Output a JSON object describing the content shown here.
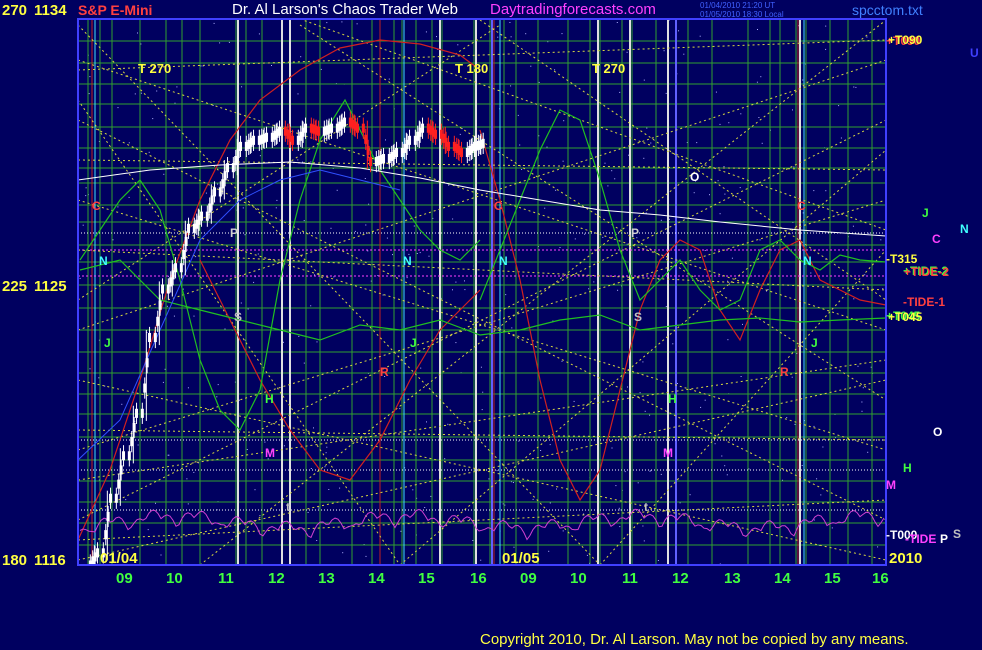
{
  "header": {
    "scale_top": "270",
    "price_top": "1134",
    "symbol": "S&P E-Mini",
    "title": "Dr. Al Larson's Chaos Trader Web",
    "site": "Daytradingforecasts.com",
    "stamp1": "01/04/2010 21:20 UT",
    "stamp2": "01/05/2010 18:30 Local",
    "file": "spcctom.txt"
  },
  "y_axis": {
    "mid_scale": "225",
    "mid_price": "1125",
    "bottom_scale": "180",
    "bottom_price": "1116"
  },
  "x_axis": {
    "dates": [
      "01/04",
      "01/05"
    ],
    "hours_day1": [
      "09",
      "10",
      "11",
      "12",
      "13",
      "14",
      "15",
      "16"
    ],
    "hours_day2": [
      "09",
      "10",
      "11",
      "12",
      "13",
      "14",
      "15",
      "16"
    ],
    "year": "2010"
  },
  "markers": {
    "t270": "T  270",
    "t180": "T  180",
    "t270b": "T  270",
    "planet_c": "C",
    "planet_n": "N",
    "planet_j": "J",
    "planet_p": "P",
    "planet_s": "S",
    "planet_h": "H",
    "planet_m": "M",
    "planet_r": "R",
    "planet_o": "O",
    "planet_u": "U",
    "planet_t": "t"
  },
  "right_labels": {
    "t090": "+T090",
    "t315": "-T315",
    "tide2": "+TIDE-2",
    "tide1": "-TIDE-1",
    "t045": "+T045",
    "t000": "-T000",
    "tide": "-TIDE"
  },
  "footer": {
    "copyright": "Copyright 2010, Dr. Al Larson. May not be copied by any means."
  },
  "colors": {
    "background": "#000060",
    "plot_border": "#4040ff",
    "grid_green": "#30a030",
    "grid_yellow": "#d8d840",
    "red_line": "#d02020",
    "green_line": "#20c020",
    "magenta_line": "#d040d0",
    "axis_text": "#ffff40",
    "hour_text": "#40ff40"
  },
  "chart_data": {
    "type": "candlestick",
    "ylim": [
      1116,
      1134
    ],
    "x_sessions": [
      "01/04",
      "01/05"
    ],
    "candles_01_04": [
      {
        "time": "08:35",
        "close": 1116.4
      },
      {
        "time": "08:50",
        "close": 1118.2
      },
      {
        "time": "09:05",
        "close": 1119.6
      },
      {
        "time": "09:20",
        "close": 1121.0
      },
      {
        "time": "09:35",
        "close": 1123.5
      },
      {
        "time": "09:50",
        "close": 1125.1
      },
      {
        "time": "10:05",
        "close": 1125.8
      },
      {
        "time": "10:20",
        "close": 1127.1
      },
      {
        "time": "10:35",
        "close": 1127.5
      },
      {
        "time": "10:50",
        "close": 1128.3
      },
      {
        "time": "11:05",
        "close": 1129.1
      },
      {
        "time": "11:20",
        "close": 1129.8
      },
      {
        "time": "11:35",
        "close": 1130.0
      },
      {
        "time": "11:50",
        "close": 1130.1
      },
      {
        "time": "12:05",
        "close": 1130.3
      },
      {
        "time": "12:20",
        "close": 1130.0
      },
      {
        "time": "12:35",
        "close": 1130.4
      },
      {
        "time": "12:50",
        "close": 1130.3
      },
      {
        "time": "13:05",
        "close": 1130.4
      },
      {
        "time": "13:20",
        "close": 1130.6
      },
      {
        "time": "13:35",
        "close": 1130.4
      },
      {
        "time": "13:50",
        "close": 1129.3
      },
      {
        "time": "14:05",
        "close": 1129.4
      },
      {
        "time": "14:20",
        "close": 1129.6
      },
      {
        "time": "14:35",
        "close": 1130.0
      },
      {
        "time": "14:50",
        "close": 1130.4
      },
      {
        "time": "15:05",
        "close": 1130.2
      },
      {
        "time": "15:20",
        "close": 1129.8
      },
      {
        "time": "15:35",
        "close": 1129.6
      },
      {
        "time": "15:50",
        "close": 1129.8
      },
      {
        "time": "16:00",
        "close": 1129.9
      }
    ]
  }
}
